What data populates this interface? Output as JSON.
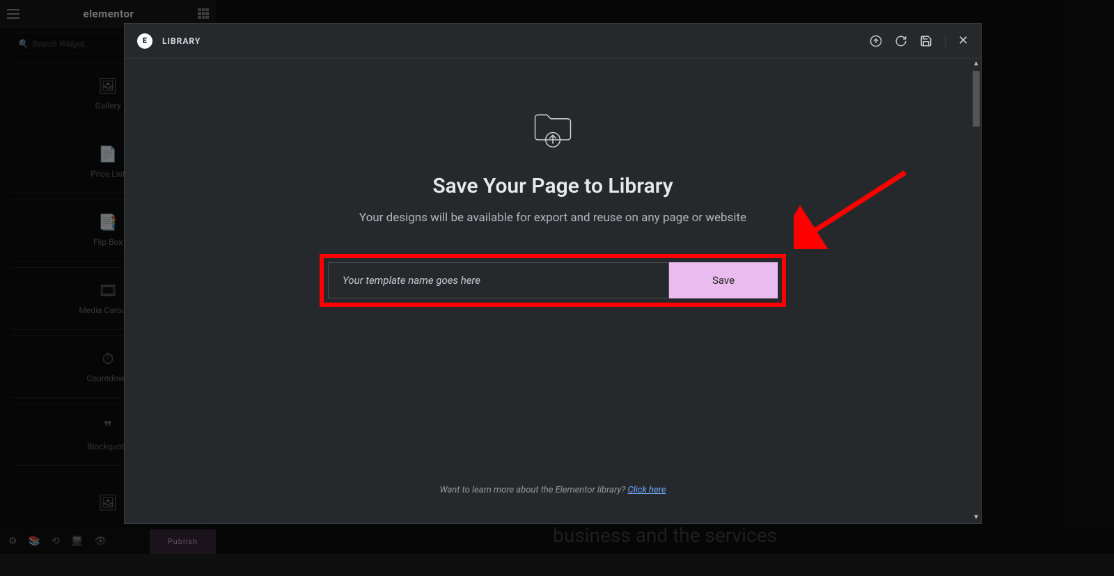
{
  "panel": {
    "brand": "elementor",
    "search_placeholder": "Search Widget...",
    "widgets": [
      {
        "label": "Gallery"
      },
      {
        "label": "Price List"
      },
      {
        "label": "Flip Box"
      },
      {
        "label": "Media Carousel"
      },
      {
        "label": "Countdown"
      },
      {
        "label": "Blockquote"
      }
    ],
    "publish": "Publish"
  },
  "canvas_text": "business and the services",
  "modal": {
    "title": "LIBRARY",
    "heading": "Save Your Page to Library",
    "subtitle": "Your designs will be available for export and reuse on any page or website",
    "input_value": "Your template name goes here",
    "save": "Save",
    "learn_prefix": "Want to learn more about the Elementor library? ",
    "learn_link": "Click here"
  }
}
